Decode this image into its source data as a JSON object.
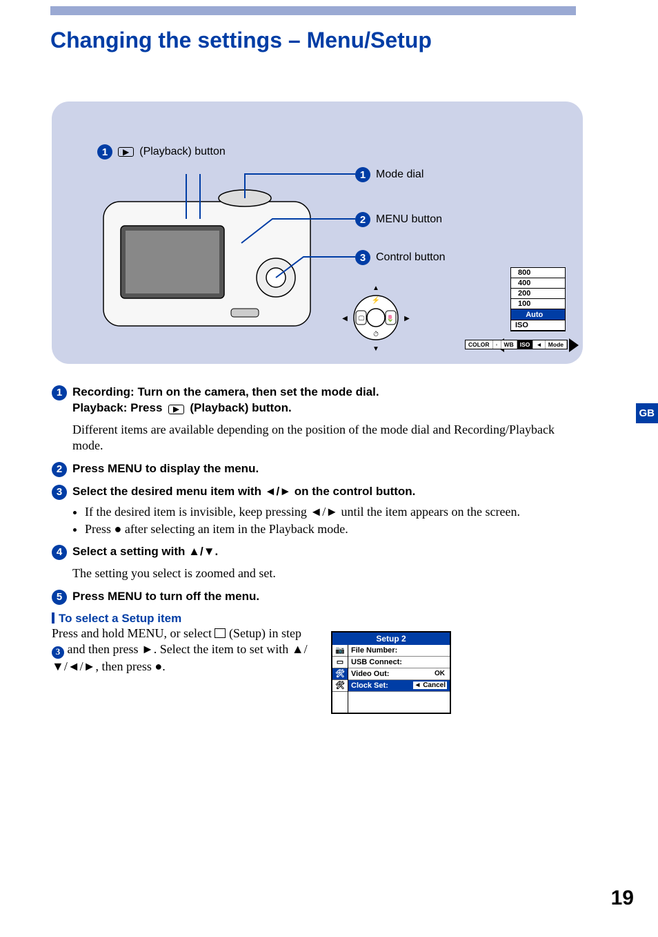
{
  "title": "Changing the settings – Menu/Setup",
  "tab": "GB",
  "page_number": "19",
  "diagram": {
    "playback_label": "(Playback) button",
    "callouts": [
      {
        "n": "1",
        "label": "Mode dial"
      },
      {
        "n": "2",
        "label": "MENU button"
      },
      {
        "n": "3",
        "label": "Control button"
      }
    ],
    "iso_values": [
      "800",
      "400",
      "200",
      "100"
    ],
    "iso_auto": "Auto",
    "iso_label": "ISO",
    "strip": [
      "COLOR",
      "",
      "WB",
      "ISO",
      "",
      "Mode"
    ]
  },
  "steps": [
    {
      "n": "1",
      "head_a": "Recording: Turn on the camera, then set the mode dial.",
      "head_b": "Playback: Press",
      "head_c": "(Playback) button.",
      "body": "Different items are available depending on the position of the mode dial and Recording/Playback mode."
    },
    {
      "n": "2",
      "head_a": "Press MENU to display the menu."
    },
    {
      "n": "3",
      "head_a": "Select the desired menu item with ◄/► on the control button.",
      "bullets": [
        "If the desired item is invisible, keep pressing ◄/► until the item appears on the screen.",
        "Press ● after selecting an item in the Playback mode."
      ]
    },
    {
      "n": "4",
      "head_a": "Select a setting with ▲/▼.",
      "body": "The setting you select is zoomed and set."
    },
    {
      "n": "5",
      "head_a": "Press MENU to turn off the menu."
    }
  ],
  "setup": {
    "heading": "To select a Setup item",
    "text_a": "Press and hold MENU, or select",
    "text_b": "(Setup) in step",
    "text_b_num": "3",
    "text_b_after": "and then press ►.",
    "text_c": "Select the item to set with ▲/▼/◄/►, then press ●.",
    "box_title": "Setup 2",
    "rows": [
      {
        "label": "File Number:",
        "val": ""
      },
      {
        "label": "USB Connect:",
        "val": ""
      },
      {
        "label": "Video Out:",
        "val": "OK"
      },
      {
        "label": "Clock Set:",
        "val": "◄ Cancel",
        "sel": true
      }
    ]
  }
}
